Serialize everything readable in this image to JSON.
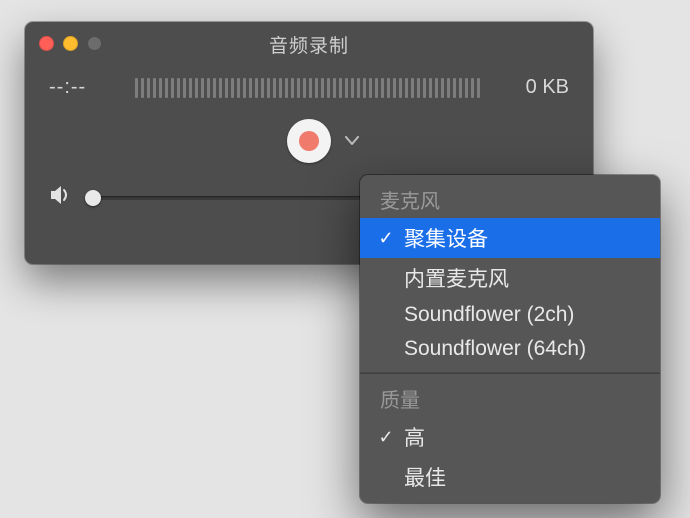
{
  "window": {
    "title": "音频录制",
    "timecode": "--:--",
    "filesize": "0 KB"
  },
  "menu": {
    "section_mic": "麦克风",
    "items_mic": [
      {
        "label": "聚集设备",
        "checked": true,
        "selected": true
      },
      {
        "label": "内置麦克风",
        "checked": false,
        "selected": false
      },
      {
        "label": "Soundflower (2ch)",
        "checked": false,
        "selected": false
      },
      {
        "label": "Soundflower (64ch)",
        "checked": false,
        "selected": false
      }
    ],
    "section_quality": "质量",
    "items_quality": [
      {
        "label": "高",
        "checked": true,
        "selected": false
      },
      {
        "label": "最佳",
        "checked": false,
        "selected": false
      }
    ]
  },
  "icons": {
    "checkmark": "✓"
  }
}
